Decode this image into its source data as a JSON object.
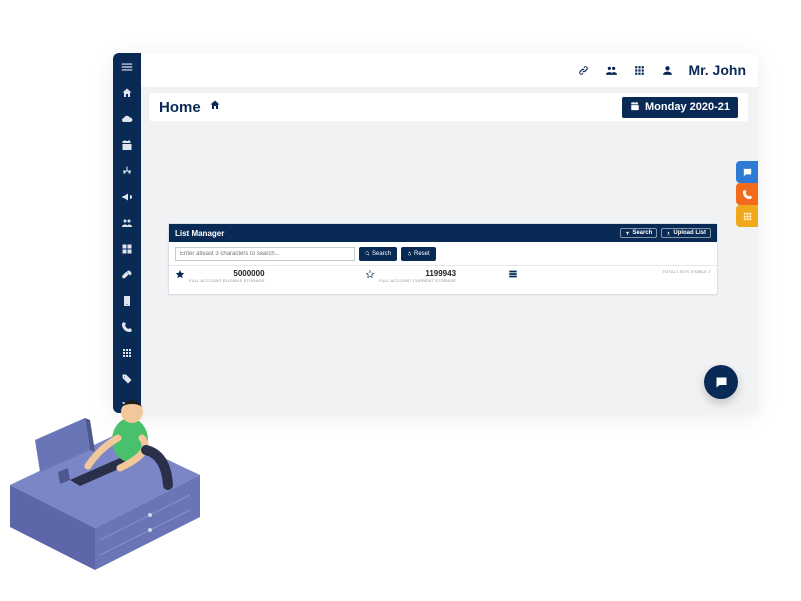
{
  "header": {
    "user_name": "Mr. John"
  },
  "breadcrumb": {
    "title": "Home",
    "date_label": "Monday 2020-21"
  },
  "panel": {
    "title": "List Manager",
    "action_search": "Search",
    "action_upload": "Upload List",
    "search_placeholder": "Enter atleast 3 characters to search...",
    "btn_search": "Search",
    "btn_reset": "Reset",
    "stats": [
      {
        "value": "5000000",
        "label": "FULL ACCOUNT ELIGIBLE STORAGE"
      },
      {
        "value": "1199943",
        "label": "FULL ACCOUNT CURRENT STORAGE"
      },
      {
        "value": "",
        "label": "TOTAL LISTS VISIBLE T"
      }
    ]
  },
  "colors": {
    "brand_navy": "#0a2a56",
    "tab_blue": "#2e7bd6",
    "tab_orange": "#f26a1b",
    "tab_yellow": "#f2a81b"
  }
}
